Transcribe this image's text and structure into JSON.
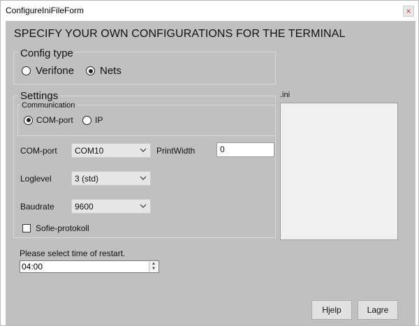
{
  "window": {
    "title": "ConfigureIniFileForm",
    "close_glyph": "×"
  },
  "heading": "SPECIFY YOUR OWN CONFIGURATIONS FOR THE TERMINAL",
  "config_type": {
    "label": "Config type",
    "options": [
      "Verifone",
      "Nets"
    ],
    "selected": "Nets"
  },
  "settings": {
    "label": "Settings",
    "communication": {
      "label": "Communication",
      "options": [
        "COM-port",
        "IP"
      ],
      "selected": "COM-port"
    },
    "com_port": {
      "label": "COM-port",
      "value": "COM10"
    },
    "print_width": {
      "label": "PrintWidth",
      "value": "0"
    },
    "log_level": {
      "label": "Loglevel",
      "value": "3 (std)"
    },
    "baud_rate": {
      "label": "Baudrate",
      "value": "9600"
    },
    "sofie": {
      "label": "Sofie-protokoll",
      "checked": false
    }
  },
  "ini": {
    "label": ".ini"
  },
  "restart": {
    "label": "Please select time of restart.",
    "value": "04:00"
  },
  "buttons": {
    "help": "Hjelp",
    "save": "Lagre"
  },
  "icons": {
    "close": "close-icon",
    "dropdown": "chevron-down-icon",
    "spin_up": "spin-up-icon",
    "spin_down": "spin-down-icon"
  }
}
